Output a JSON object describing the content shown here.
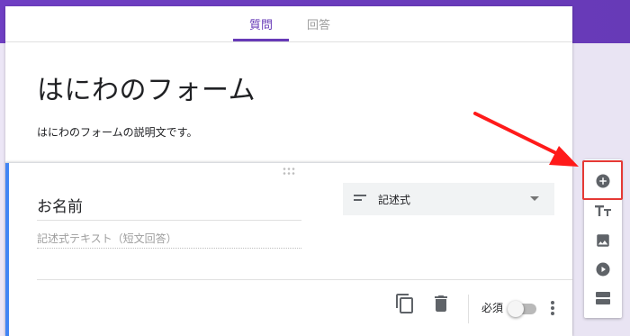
{
  "tabs": {
    "questions": "質問",
    "answers": "回答"
  },
  "form": {
    "title": "はにわのフォーム",
    "description": "はにわのフォームの説明文です。"
  },
  "question": {
    "title": "お名前",
    "answer_placeholder": "記述式テキスト（短文回答）",
    "type": "記述式",
    "required_label": "必須",
    "required": false
  },
  "icons": {
    "drag": "drag-handle-icon",
    "type": "short-text-icon",
    "dropdown": "caret-down-icon",
    "copy": "copy-icon",
    "delete": "trash-icon",
    "more": "more-vert-icon",
    "add_question": "add-circle-icon",
    "add_title": "text-title-icon",
    "add_image": "image-icon",
    "add_video": "video-icon",
    "add_section": "section-icon"
  },
  "colors": {
    "accent": "#673ab7",
    "highlight": "#e53935",
    "focus_bar": "#4285f4"
  }
}
